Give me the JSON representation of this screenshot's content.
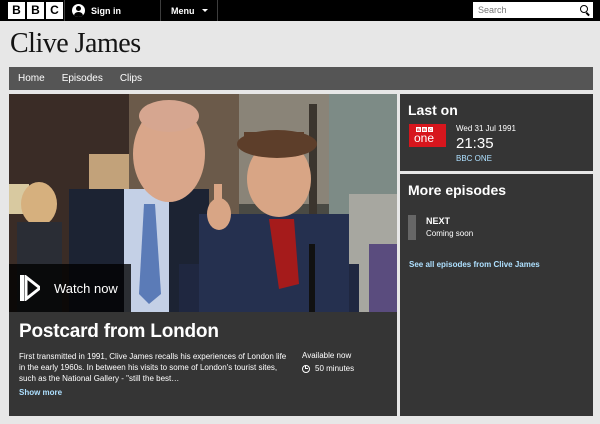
{
  "topbar": {
    "logo_letters": [
      "B",
      "B",
      "C"
    ],
    "signin_label": "Sign in",
    "menu_label": "Menu",
    "search_placeholder": "Search"
  },
  "header": {
    "title": "Clive James"
  },
  "nav": {
    "items": [
      "Home",
      "Episodes",
      "Clips"
    ]
  },
  "hero": {
    "watch_label": "Watch now",
    "title": "Postcard from London",
    "description": "First transmitted in 1991, Clive James recalls his experiences of London life in the early 1960s. In between his visits to some of London's tourist sites, such as the National Gallery - \"still the best…",
    "availability": "Available now",
    "duration": "50 minutes",
    "show_more": "Show more"
  },
  "last_on": {
    "heading": "Last on",
    "channel_logo_letters": [
      "B",
      "B",
      "C"
    ],
    "channel_logo_word": "one",
    "date": "Wed 31 Jul 1991",
    "time": "21:35",
    "channel": "BBC ONE"
  },
  "more_episodes": {
    "heading": "More episodes",
    "next_label": "NEXT",
    "next_status": "Coming soon",
    "see_all": "See all episodes from Clive James"
  },
  "colors": {
    "topbar": "#000000",
    "nav": "#555555",
    "panel": "#353535",
    "link": "#aee0ff",
    "bbc_one_red": "#d7161d"
  }
}
